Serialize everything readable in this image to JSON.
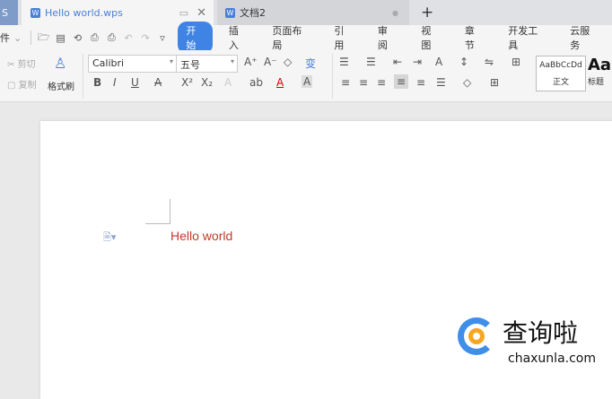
{
  "tabs": [
    {
      "label": "Hello world.wps",
      "active": true
    },
    {
      "label": "文档2",
      "active": false
    }
  ],
  "tab_left_stub": "S",
  "new_tab": "+",
  "menu": {
    "file": "件",
    "items": [
      "开始",
      "插入",
      "页面布局",
      "引用",
      "审阅",
      "视图",
      "章节",
      "开发工具",
      "云服务"
    ],
    "active": "开始"
  },
  "clipboard": {
    "cut": "剪切",
    "copy": "复制",
    "format_painter": "格式刷"
  },
  "font": {
    "name": "Calibri",
    "size": "五号"
  },
  "styles": [
    {
      "preview": "AaBbCcDd",
      "label": "正文"
    },
    {
      "preview": "Aa",
      "label": "标题"
    }
  ],
  "document": {
    "text": "Hello world"
  },
  "watermark": {
    "name": "查询啦",
    "url": "chaxunla.com"
  },
  "colors": {
    "accent": "#3f84e5",
    "text": "#c0392b"
  }
}
